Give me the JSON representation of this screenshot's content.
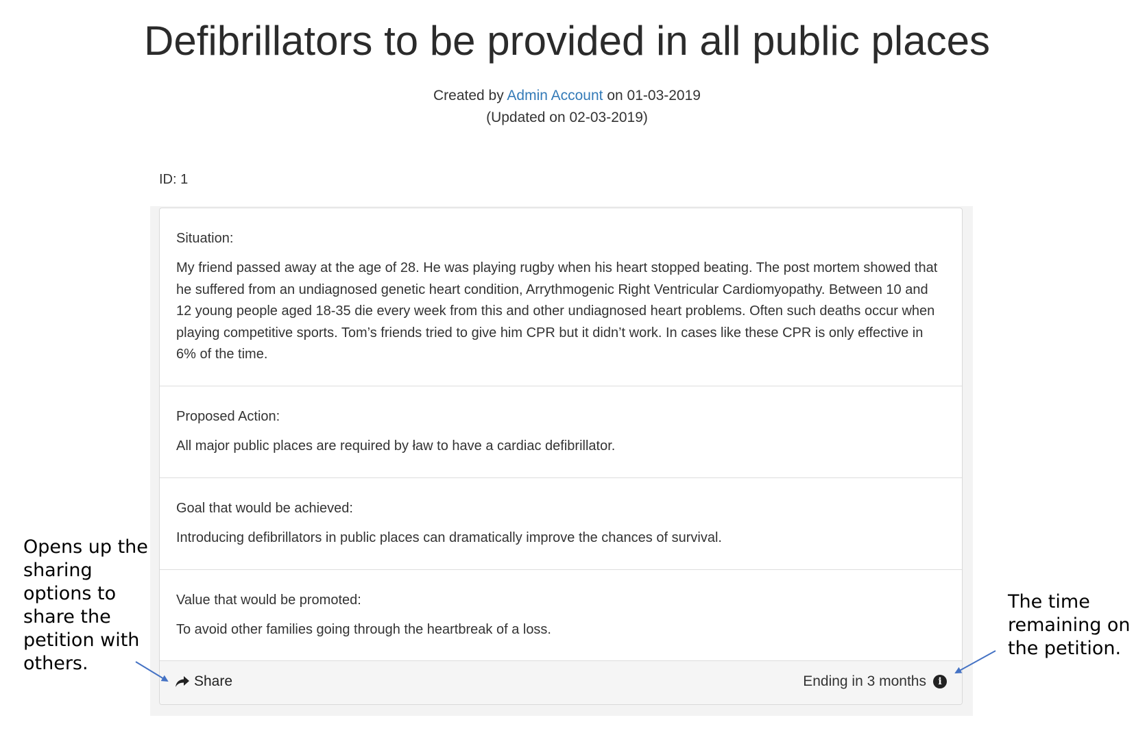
{
  "petition": {
    "title": "Defibrillators to be provided in all public places",
    "created_prefix": "Created by ",
    "author": "Admin Account",
    "created_suffix": " on 01-03-2019",
    "updated": "(Updated on 02-03-2019)",
    "id_label": "ID: 1",
    "sections": {
      "situation": {
        "heading": "Situation:",
        "body": "My friend passed away at the age of 28. He was playing rugby when his heart stopped beating. The post mortem showed that he suffered from an undiagnosed genetic heart condition, Arrythmogenic Right Ventricular Cardiomyopathy. Between 10 and 12 young people aged 18-35 die every week from this and other undiagnosed heart problems. Often such deaths occur when playing competitive sports. Tom’s friends tried to give him CPR but it didn’t work. In cases like these CPR is only effective in 6% of the time."
      },
      "action": {
        "heading": "Proposed Action:",
        "body": "All major public places are required by ław to have a cardiac defibrillator."
      },
      "goal": {
        "heading": "Goal that would be achieved:",
        "body": "Introducing defibrillators in public places can dramatically improve the chances of survival."
      },
      "value": {
        "heading": "Value that would be promoted:",
        "body": "To avoid other families going through the heartbreak of a loss."
      }
    },
    "footer": {
      "share_label": "Share",
      "ending_label": "Ending in 3 months",
      "info_glyph": "i"
    }
  },
  "annotations": {
    "left": "Opens up the\nsharing\noptions to\nshare the\npetition with\nothers.",
    "right": "The time\nremaining on\nthe petition."
  },
  "colors": {
    "link": "#337ab7",
    "annotation_arrow": "#4472c4",
    "footer_bg": "#f5f5f5"
  }
}
